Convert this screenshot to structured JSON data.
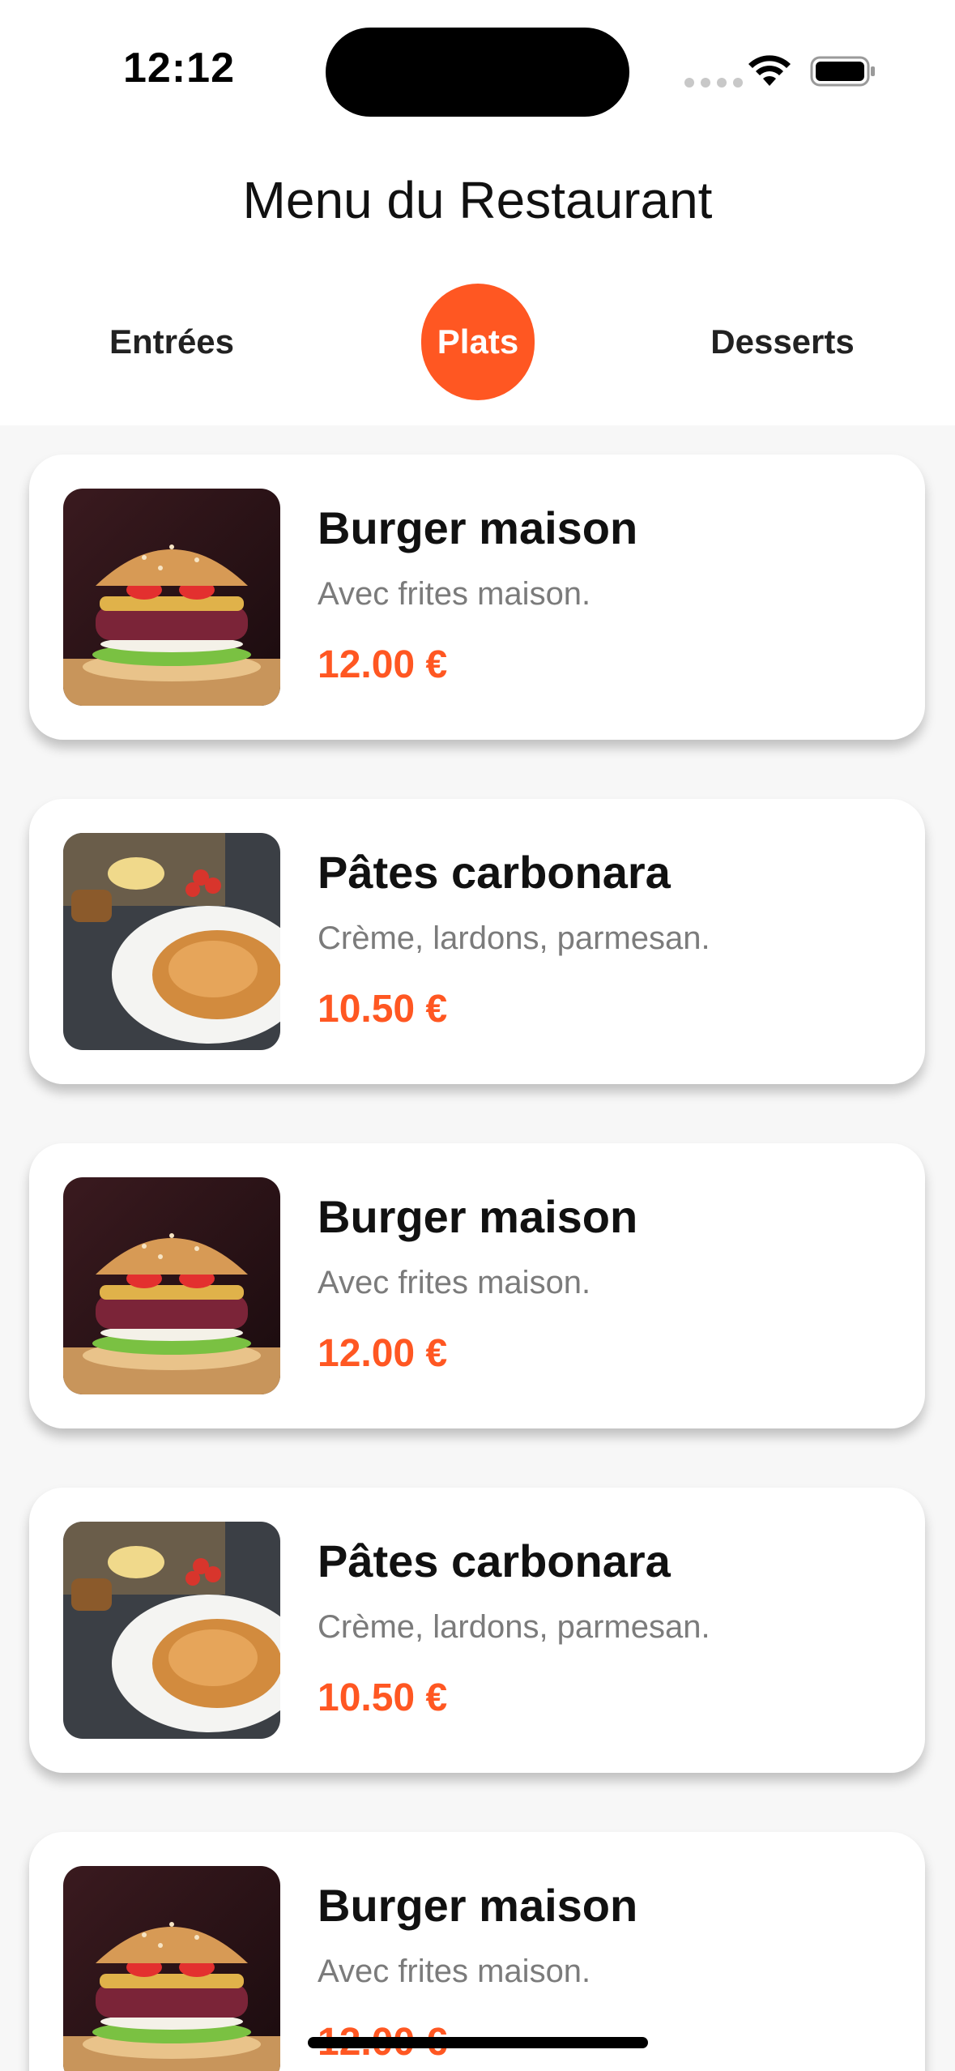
{
  "status_bar": {
    "time": "12:12"
  },
  "header": {
    "title": "Menu du Restaurant"
  },
  "tabs": [
    {
      "label": "Entrées",
      "active": false
    },
    {
      "label": "Plats",
      "active": true
    },
    {
      "label": "Desserts",
      "active": false
    }
  ],
  "colors": {
    "accent": "#ff5722",
    "background": "#f7f7f7"
  },
  "items": [
    {
      "name": "Burger maison",
      "description": "Avec frites maison.",
      "price": "12.00 €",
      "image": "burger-photo"
    },
    {
      "name": "Pâtes carbonara",
      "description": "Crème, lardons, parmesan.",
      "price": "10.50 €",
      "image": "pasta-photo"
    },
    {
      "name": "Burger maison",
      "description": "Avec frites maison.",
      "price": "12.00 €",
      "image": "burger-photo"
    },
    {
      "name": "Pâtes carbonara",
      "description": "Crème, lardons, parmesan.",
      "price": "10.50 €",
      "image": "pasta-photo"
    },
    {
      "name": "Burger maison",
      "description": "Avec frites maison.",
      "price": "12.00 €",
      "image": "burger-photo"
    }
  ]
}
